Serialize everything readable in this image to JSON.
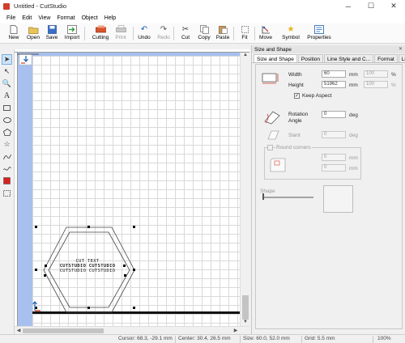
{
  "window": {
    "title": "Untitled - CutStudio",
    "minimize_glyph": "─",
    "maximize_glyph": "☐",
    "close_glyph": "✕"
  },
  "menu": [
    "File",
    "Edit",
    "View",
    "Format",
    "Object",
    "Help"
  ],
  "toolbar": {
    "new": "New",
    "open": "Open",
    "save": "Save",
    "import": "Import",
    "cutting": "Cutting",
    "print": "Print",
    "undo": "Undo",
    "redo": "Redo",
    "cut": "Cut",
    "copy": "Copy",
    "paste": "Paste",
    "fit": "Fit",
    "move": "Move",
    "symbol": "Symbol",
    "properties": "Properties"
  },
  "canvas": {
    "text_line1": "CUT TEXT",
    "text_line2": "CUTSTUDIO CUTSTUDIO",
    "selected_object": "hexagon with text"
  },
  "panel": {
    "title": "Size and Shape",
    "tabs": [
      "Size and Shape",
      "Position",
      "Line Style and C...",
      "Format",
      "Links"
    ],
    "width_label": "Width",
    "height_label": "Height",
    "width_value": "60",
    "height_value": "51962",
    "width_pct": "100",
    "height_pct": "100",
    "unit_mm": "mm",
    "unit_pct": "%",
    "keep_aspect": "Keep Aspect",
    "rotation_label_1": "Rotation",
    "rotation_label_2": "Angle",
    "rotation_value": "0",
    "unit_deg": "deg",
    "slant_label": "Slant",
    "slant_value": "0",
    "round_corners": "Round corners",
    "corner_value_1": "0",
    "corner_value_2": "0",
    "shape_label": "Shape"
  },
  "status": {
    "cursor": "Cursor: 68.3, -29.1 mm",
    "center": "Center: 30.4, 26.5 mm",
    "size": "Size: 60.0, 52.0 mm",
    "grid": "Grid: 5.5 mm",
    "zoom": "100%"
  },
  "colors": {
    "canvas_bg": "#a7c0ee",
    "accent_red": "#d23c2c",
    "accent_blue": "#1a5fb4"
  }
}
